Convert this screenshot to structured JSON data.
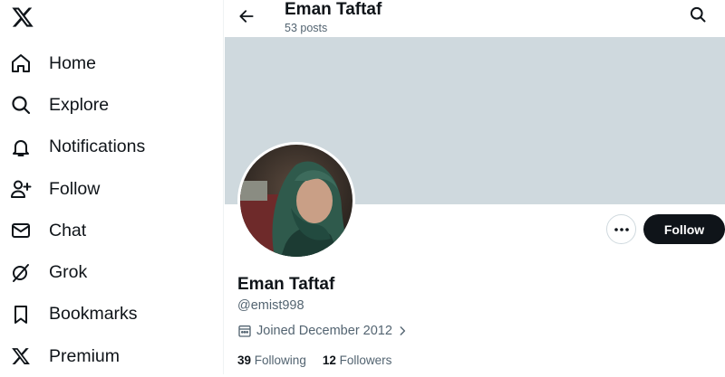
{
  "nav": {
    "items": [
      {
        "label": "Home",
        "icon": "home-icon"
      },
      {
        "label": "Explore",
        "icon": "search-icon"
      },
      {
        "label": "Notifications",
        "icon": "bell-icon"
      },
      {
        "label": "Follow",
        "icon": "add-person-icon"
      },
      {
        "label": "Chat",
        "icon": "mail-icon"
      },
      {
        "label": "Grok",
        "icon": "grok-icon"
      },
      {
        "label": "Bookmarks",
        "icon": "bookmark-icon"
      },
      {
        "label": "Premium",
        "icon": "x-logo-icon"
      }
    ]
  },
  "header": {
    "name": "Eman Taftaf",
    "posts": "53 posts"
  },
  "profile": {
    "name": "Eman Taftaf",
    "handle": "@emist998",
    "joined": "Joined December 2012",
    "following_count": "39",
    "following_label": "Following",
    "followers_count": "12",
    "followers_label": "Followers"
  },
  "actions": {
    "follow_label": "Follow"
  },
  "colors": {
    "banner": "#cfd9de",
    "text_primary": "#0f1419",
    "text_secondary": "#536471",
    "follow_bg": "#0f1419"
  }
}
